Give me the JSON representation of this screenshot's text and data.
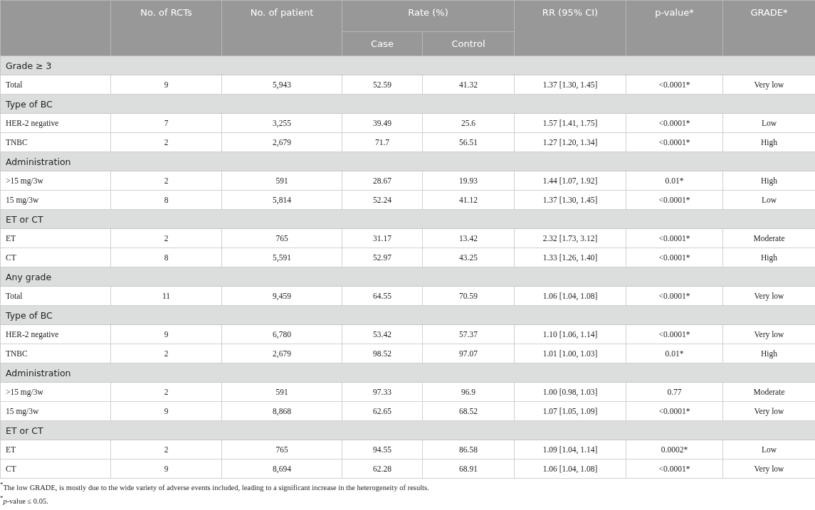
{
  "table": {
    "columns": [
      "No. of RCTs",
      "No. of patient",
      "Rate (%)",
      "RR (95% CI)",
      "p-value*",
      "GRADE*"
    ],
    "subcolumns": [
      "Case",
      "Control"
    ],
    "sections": [
      {
        "label": "Grade ≥ 3",
        "rows": [
          [
            "Total",
            "9",
            "5,943",
            "52.59",
            "41.32",
            "1.37 [1.30, 1.45]",
            "<0.0001*",
            "Very low"
          ]
        ]
      },
      {
        "label": "Type of BC",
        "rows": [
          [
            "HER-2 negative",
            "7",
            "3,255",
            "39.49",
            "25.6",
            "1.57 [1.41, 1.75]",
            "<0.0001*",
            "Low"
          ],
          [
            "TNBC",
            "2",
            "2,679",
            "71.7",
            "56.51",
            "1.27 [1.20, 1.34]",
            "<0.0001*",
            "High"
          ]
        ]
      },
      {
        "label": "Administration",
        "rows": [
          [
            ">15 mg/3w",
            "2",
            "591",
            "28.67",
            "19.93",
            "1.44 [1.07, 1.92]",
            "0.01*",
            "High"
          ],
          [
            "15 mg/3w",
            "8",
            "5,814",
            "52.24",
            "41.12",
            "1.37 [1.30, 1.45]",
            "<0.0001*",
            "Low"
          ]
        ]
      },
      {
        "label": "ET or CT",
        "rows": [
          [
            "ET",
            "2",
            "765",
            "31.17",
            "13.42",
            "2.32 [1.73, 3.12]",
            "<0.0001*",
            "Moderate"
          ],
          [
            "CT",
            "8",
            "5,591",
            "52.97",
            "43.25",
            "1.33 [1.26, 1.40]",
            "<0.0001*",
            "High"
          ]
        ]
      },
      {
        "label": "Any grade",
        "rows": [
          [
            "Total",
            "11",
            "9,459",
            "64.55",
            "70.59",
            "1.06 [1.04, 1.08]",
            "<0.0001*",
            "Very low"
          ]
        ]
      },
      {
        "label": "Type of BC",
        "rows": [
          [
            "HER-2 negative",
            "9",
            "6,780",
            "53.42",
            "57.37",
            "1.10 [1.06, 1.14]",
            "<0.0001*",
            "Very low"
          ],
          [
            "TNBC",
            "2",
            "2,679",
            "98.52",
            "97.07",
            "1.01 [1.00, 1.03]",
            "0.01*",
            "High"
          ]
        ]
      },
      {
        "label": "Administration",
        "rows": [
          [
            ">15 mg/3w",
            "2",
            "591",
            "97.33",
            "96.9",
            "1.00 [0.98, 1.03]",
            "0.77",
            "Moderate"
          ],
          [
            "15 mg/3w",
            "9",
            "8,868",
            "62.65",
            "68.52",
            "1.07 [1.05, 1.09]",
            "<0.0001*",
            "Very low"
          ]
        ]
      },
      {
        "label": "ET or CT",
        "rows": [
          [
            "ET",
            "2",
            "765",
            "94.55",
            "86.58",
            "1.09 [1.04, 1.14]",
            "0.0002*",
            "Low"
          ],
          [
            "CT",
            "9",
            "8,694",
            "62.28",
            "68.91",
            "1.06 [1.04, 1.08]",
            "<0.0001*",
            "Very low"
          ]
        ]
      }
    ]
  },
  "footnotes": [
    "$^{*}$The low GRADE, is mostly due to the wide variety of adverse events included, leading to a significant increase in the heterogeneity of results.",
    "$^{*}$*p*-value ≤ 0.05."
  ]
}
